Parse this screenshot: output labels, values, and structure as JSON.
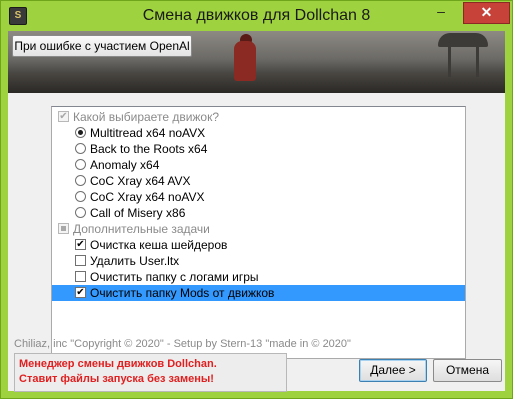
{
  "window": {
    "title": "Смена движков для Dollchan 8",
    "icon": "app-icon",
    "controls": {
      "minimize": "–",
      "maximize": "□",
      "close": "✕"
    },
    "accent_color": "#9fd23f"
  },
  "banner": {
    "button_label": "При ошибке с участием OpenAl"
  },
  "tree": {
    "engine_group": {
      "label": "Какой выбираете движок?",
      "checked": true
    },
    "engines": [
      {
        "label": "Multitread x64 noAVX",
        "selected": true
      },
      {
        "label": "Back to the Roots x64",
        "selected": false
      },
      {
        "label": "Anomaly x64",
        "selected": false
      },
      {
        "label": "CoC Xray x64 AVX",
        "selected": false
      },
      {
        "label": "CoC Xray x64 noAVX",
        "selected": false
      },
      {
        "label": "Call of Misery x86",
        "selected": false
      }
    ],
    "tasks_group": {
      "label": "Дополнительные задачи",
      "state": "indeterminate"
    },
    "tasks": [
      {
        "label": "Очистка кеша шейдеров",
        "checked": true,
        "highlighted": false
      },
      {
        "label": "Удалить User.ltx",
        "checked": false,
        "highlighted": false
      },
      {
        "label": "Очистить папку с логами игры",
        "checked": false,
        "highlighted": false
      },
      {
        "label": "Очистить папку Mods от движков",
        "checked": true,
        "highlighted": true
      }
    ]
  },
  "footer": {
    "copyright": "Chiliaz, inc \"Copyright © 2020\" - Setup by Stern-13 \"made in © 2020\"",
    "warning_line1": "Менеджер смены движков Dollchan.",
    "warning_line2": "Ставит файлы запуска без замены!",
    "warning_color": "#e02020",
    "next_label": "Далее >",
    "cancel_label": "Отмена"
  }
}
